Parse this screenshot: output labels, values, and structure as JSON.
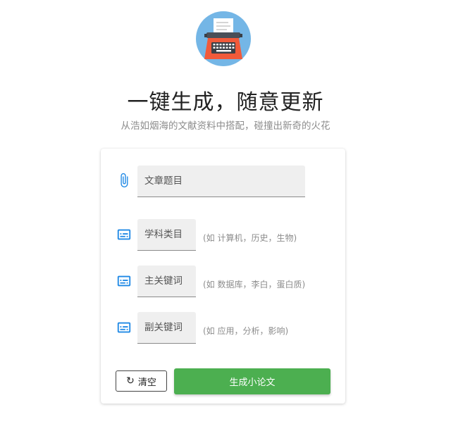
{
  "header": {
    "logo_icon": "typewriter-icon",
    "title": "一键生成，随意更新",
    "subtitle": "从浩如烟海的文献资料中搭配，碰撞出新奇的火花"
  },
  "form": {
    "title_field": {
      "icon": "paperclip-icon",
      "placeholder": "文章题目",
      "value": ""
    },
    "subject_field": {
      "icon": "subtitles-icon",
      "placeholder": "学科类目",
      "value": "",
      "hint": "(如 计算机，历史，生物)"
    },
    "main_keyword_field": {
      "icon": "subtitles-icon",
      "placeholder": "主关键词",
      "value": "",
      "hint": "(如 数据库，李白，蛋白质)"
    },
    "sub_keyword_field": {
      "icon": "subtitles-icon",
      "placeholder": "副关键词",
      "value": "",
      "hint": "(如 应用，分析，影响)"
    }
  },
  "actions": {
    "clear_icon": "refresh-icon",
    "clear_label": "清空",
    "generate_label": "生成小论文"
  },
  "colors": {
    "accent_blue": "#1e88e5",
    "primary_green": "#4caf50",
    "logo_bg": "#74b6e6",
    "typewriter_red": "#f15a3a"
  }
}
